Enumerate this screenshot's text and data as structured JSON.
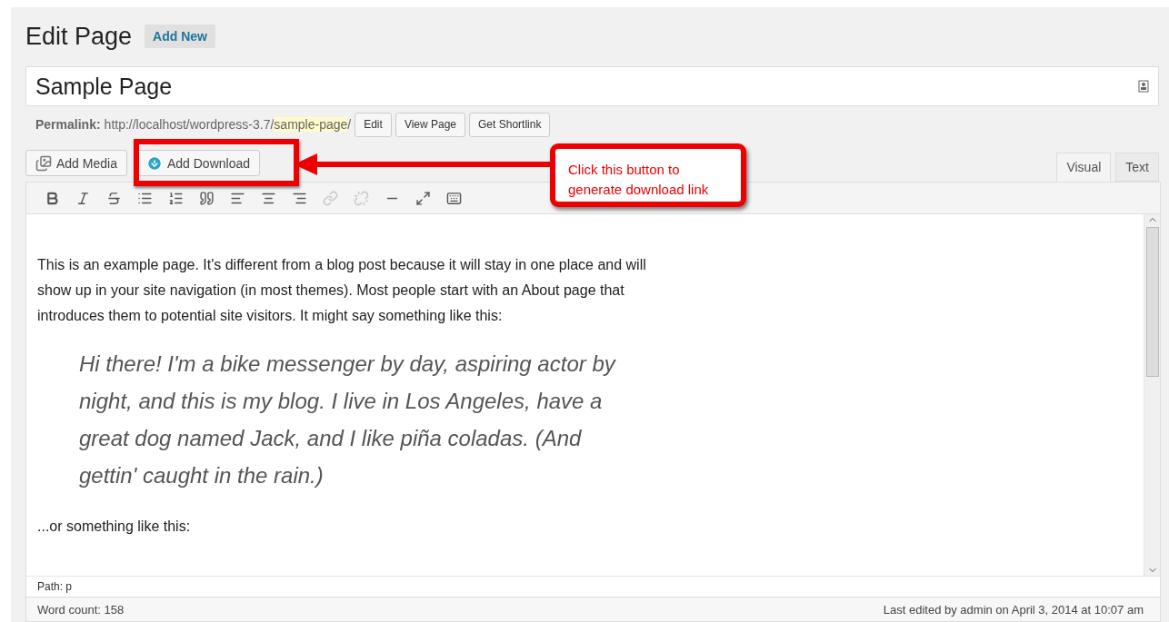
{
  "heading": {
    "title": "Edit Page",
    "add_new": "Add New"
  },
  "post_title": "Sample Page",
  "permalink": {
    "label": "Permalink:",
    "base": "http://localhost/wordpress-3.7/",
    "slug": "sample-page",
    "trail": "/",
    "buttons": [
      "Edit",
      "View Page",
      "Get Shortlink"
    ]
  },
  "media_buttons": [
    {
      "kind": "media",
      "label": "Add Media"
    },
    {
      "kind": "download",
      "label": "Add Download"
    }
  ],
  "editor_tabs": [
    {
      "label": "Visual",
      "selected": true
    },
    {
      "label": "Text",
      "selected": false
    }
  ],
  "toolbar": [
    {
      "kind": "bold",
      "disabled": false
    },
    {
      "kind": "italic",
      "disabled": false
    },
    {
      "kind": "strike",
      "disabled": false
    },
    {
      "kind": "bullets",
      "disabled": false
    },
    {
      "kind": "numbers",
      "disabled": false
    },
    {
      "kind": "quote",
      "disabled": false
    },
    {
      "kind": "align-left",
      "disabled": false
    },
    {
      "kind": "align-center",
      "disabled": false
    },
    {
      "kind": "align-right",
      "disabled": false
    },
    {
      "kind": "link",
      "disabled": true
    },
    {
      "kind": "unlink",
      "disabled": true
    },
    {
      "kind": "more",
      "disabled": false
    },
    {
      "kind": "fullscreen",
      "disabled": false
    },
    {
      "kind": "kitchen-sink",
      "disabled": false
    }
  ],
  "content": [
    {
      "kind": "paragraph",
      "text": "This is an example page. It's different from a blog post because it will stay in one place and will show up in your site navigation (in most themes). Most people start with an About page that introduces them to potential site visitors. It might say something like this:"
    },
    {
      "kind": "quote",
      "text": "Hi there! I'm a bike messenger by day, aspiring actor by night, and this is my blog. I live in Los Angeles, have a great dog named Jack, and I like piña coladas. (And gettin' caught in the rain.)"
    },
    {
      "kind": "paragraph",
      "text": "...or something like this:"
    }
  ],
  "path": "Path: p",
  "word_count": "Word count: 158",
  "last_edited": "Last edited by admin on April 3, 2014 at 10:07 am",
  "callout": "Click this button to generate download link"
}
